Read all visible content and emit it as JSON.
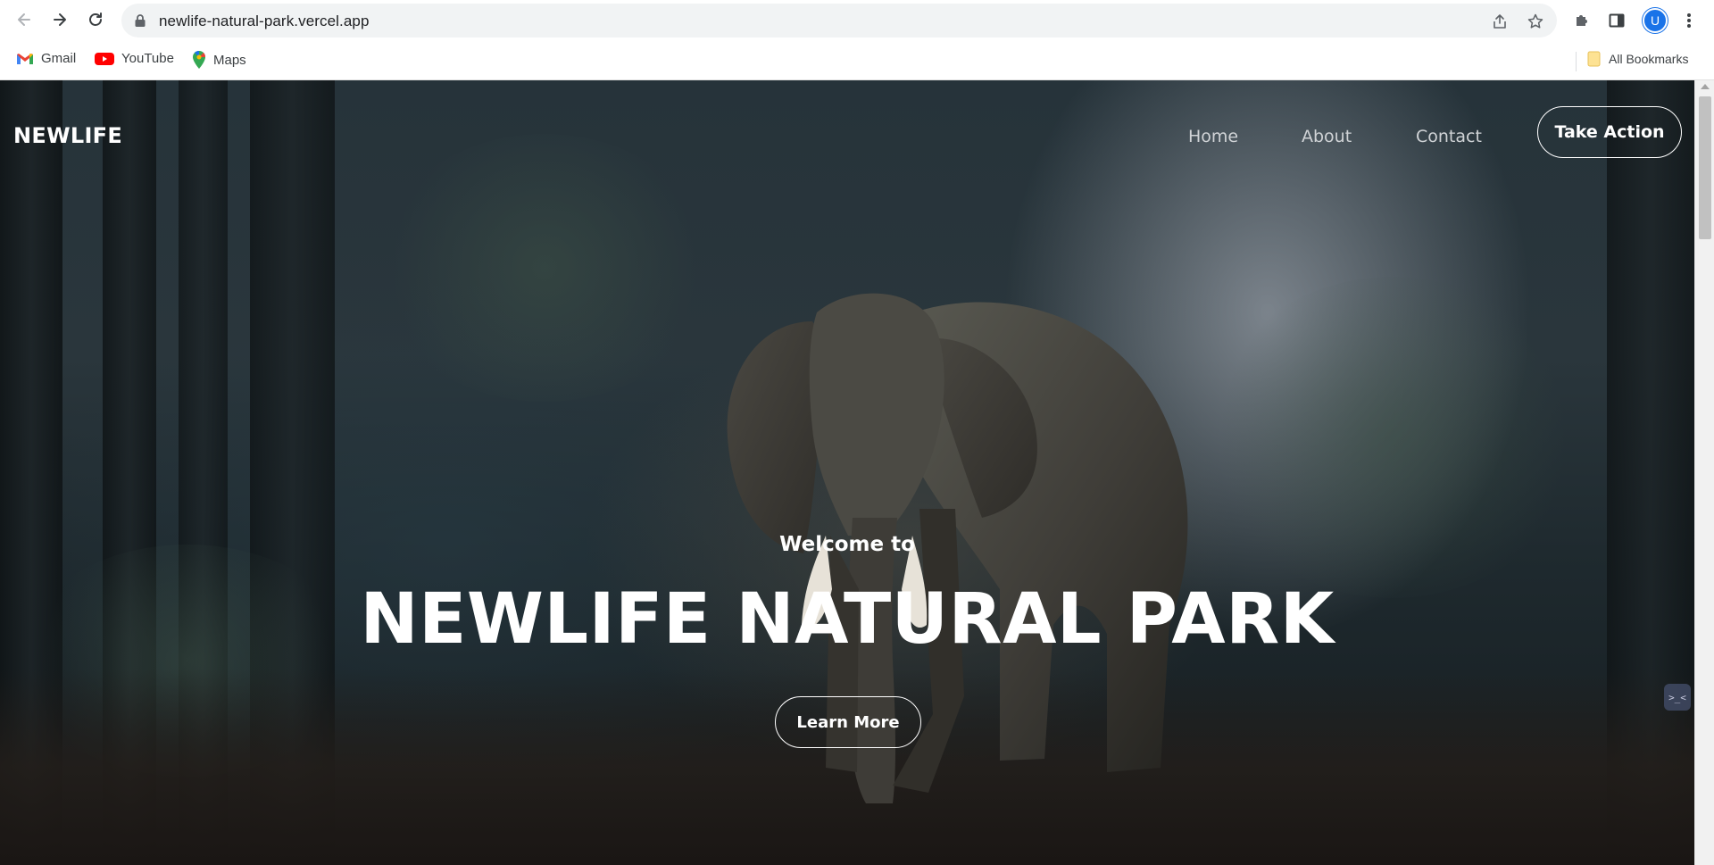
{
  "browser": {
    "url": "newlife-natural-park.vercel.app",
    "profile_initial": "U",
    "bookmarks": [
      {
        "label": "Gmail",
        "icon": "gmail-icon"
      },
      {
        "label": "YouTube",
        "icon": "youtube-icon"
      },
      {
        "label": "Maps",
        "icon": "maps-icon"
      }
    ],
    "all_bookmarks_label": "All Bookmarks"
  },
  "site": {
    "logo": "NEWLIFE",
    "nav": {
      "home": "Home",
      "about": "About",
      "contact": "Contact"
    },
    "cta_label": "Take Action",
    "hero": {
      "welcome": "Welcome to",
      "title": "NEWLIFE NATURAL PARK",
      "button_label": "Learn More"
    },
    "widget_glyph": ">_<"
  },
  "colors": {
    "accent_white": "#ffffff",
    "nav_text": "#d0d3d6",
    "profile_blue": "#1a73e8"
  }
}
